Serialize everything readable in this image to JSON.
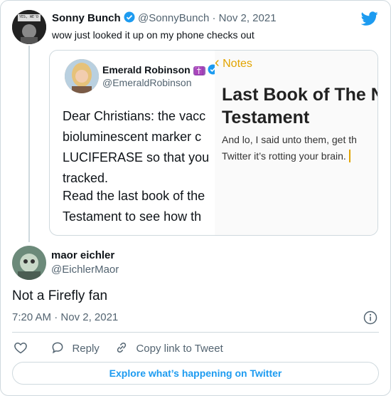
{
  "colors": {
    "accent": "#1d9bf0",
    "muted": "#536471",
    "notes_accent": "#e2a400",
    "border": "#cfd9de"
  },
  "main_tweet": {
    "name": "Sonny Bunch",
    "handle": "@SonnyBunch",
    "sep": "·",
    "date": "Nov 2, 2021",
    "text": "wow just looked it up on my phone checks out"
  },
  "quoted": {
    "name": "Emerald Robinson",
    "name_emoji": "✝️",
    "handle": "@EmeraldRobinson",
    "lines": [
      "Dear Christians: the vacc",
      "bioluminescent marker c",
      "LUCIFERASE so that you",
      "tracked."
    ],
    "lines2": [
      "Read the last book of the",
      "Testament to see how th"
    ]
  },
  "notes": {
    "back_label": "Notes",
    "title_line1": "Last Book of The N",
    "title_line2": "Testament",
    "body_line1": "And lo, I said unto them, get th",
    "body_line2": "Twitter it’s rotting your brain."
  },
  "reply_tweet": {
    "name": "maor eichler",
    "handle": "@EichlerMaor",
    "text": "Not a Firefly fan",
    "time": "7:20 AM",
    "sep": "·",
    "date": "Nov 2, 2021"
  },
  "actions": {
    "reply_label": "Reply",
    "copy_label": "Copy link to Tweet"
  },
  "explore_label": "Explore what’s happening on Twitter",
  "avatar_tag": "YES, WE'D"
}
